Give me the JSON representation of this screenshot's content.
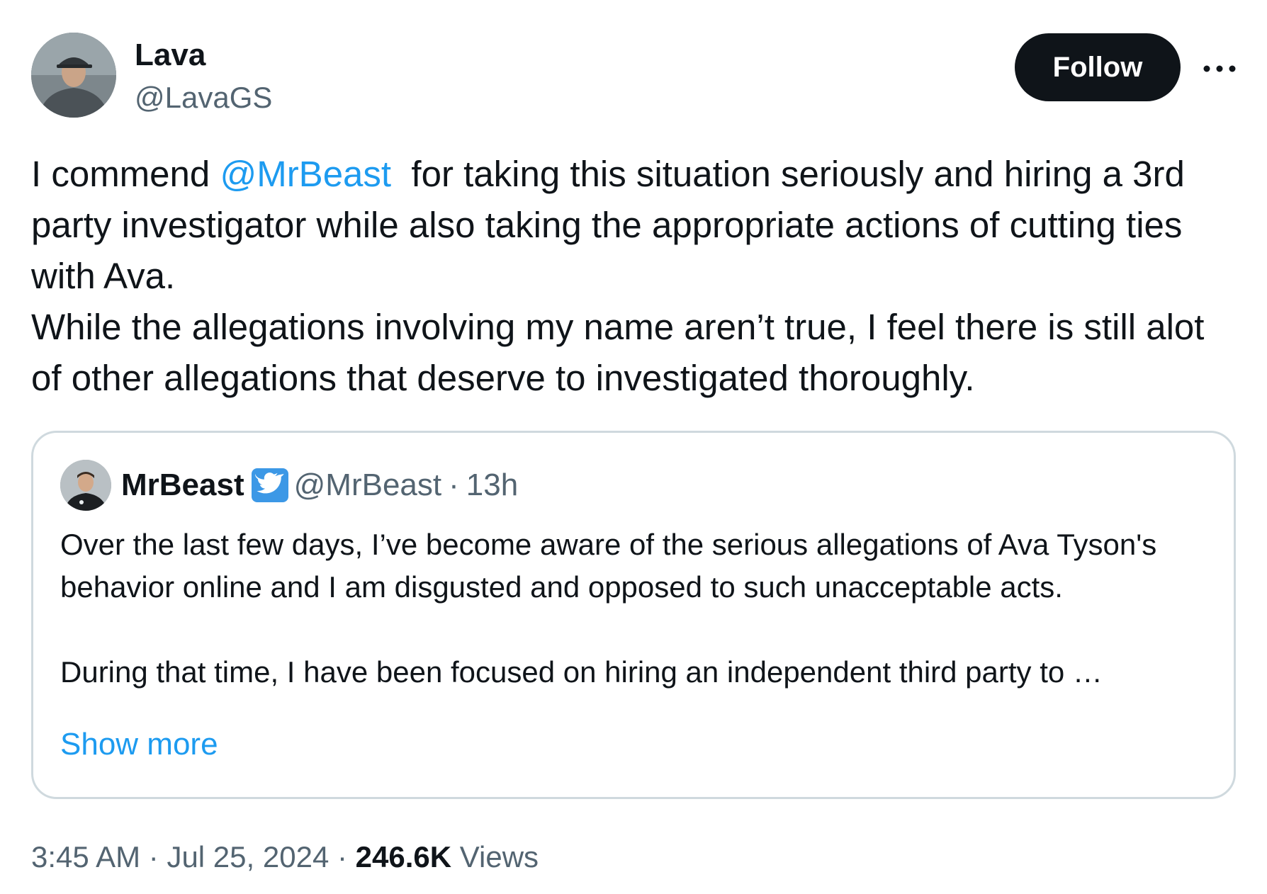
{
  "author": {
    "display_name": "Lava",
    "handle": "@LavaGS",
    "avatar_icon": "user-photo-avatar"
  },
  "header": {
    "follow_label": "Follow",
    "more_icon": "more-horizontal-icon"
  },
  "tweet": {
    "text_before_mention": "I commend ",
    "mention": "@MrBeast",
    "text_after_mention": "  for taking this situation seriously and hiring a 3rd party investigator while also taking the appropriate actions of cutting ties with Ava.",
    "paragraph_2": "While the allegations involving my name aren’t true, I feel there is still alot of other allegations that deserve to investigated thoroughly."
  },
  "quote": {
    "display_name": "MrBeast",
    "verified_icon": "bird-verified-badge-icon",
    "handle": "@MrBeast",
    "separator": "·",
    "time": "13h",
    "paragraph_1": "Over the last few days, I’ve become aware of the serious allegations of Ava Tyson's behavior online and I am disgusted and opposed to such unacceptable acts.",
    "paragraph_2": "During that time, I have been focused on hiring an independent third party to …",
    "show_more_label": "Show more"
  },
  "footer": {
    "time": "3:45 AM",
    "separator_1": "·",
    "date": "Jul 25, 2024",
    "separator_2": "·",
    "views_count": "246.6K",
    "views_label": "Views"
  },
  "colors": {
    "link": "#1d9bf0",
    "secondary_text": "#536471",
    "primary_text": "#0f1419",
    "border": "#cfd9de",
    "badge": "#3c98e6"
  }
}
